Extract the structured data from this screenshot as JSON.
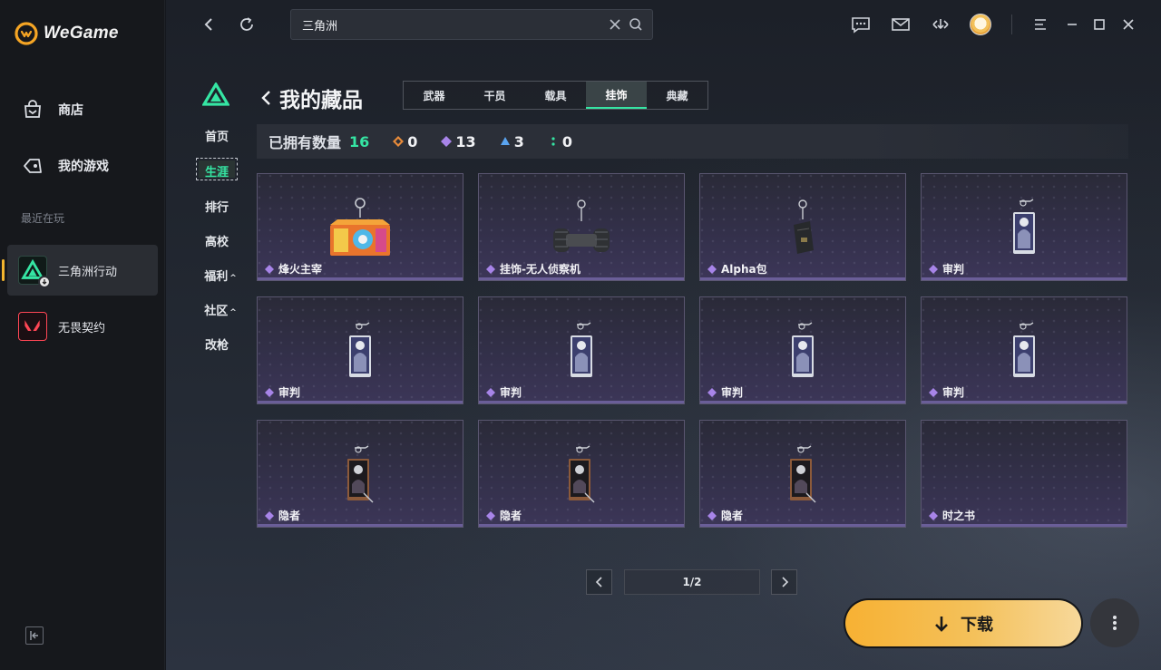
{
  "app": {
    "brand": "WeGame"
  },
  "sidebar": {
    "nav": [
      {
        "label": "商店",
        "icon": "shop-bag-icon"
      },
      {
        "label": "我的游戏",
        "icon": "gamepad-icon"
      }
    ],
    "recent_label": "最近在玩",
    "games": [
      {
        "label": "三角洲行动",
        "icon": "delta-force-icon",
        "active": true
      },
      {
        "label": "无畏契约",
        "icon": "valorant-icon",
        "active": false
      }
    ]
  },
  "topbar": {
    "search_value": "三角洲"
  },
  "game_nav": {
    "items": [
      "首页",
      "生涯",
      "排行",
      "高校",
      "福利",
      "社区",
      "改枪"
    ],
    "active": "生涯",
    "expandable": [
      "福利",
      "社区"
    ]
  },
  "collection": {
    "title": "我的藏品",
    "tabs": [
      "武器",
      "干员",
      "载具",
      "挂饰",
      "典藏"
    ],
    "active_tab": "挂饰",
    "stats": {
      "label": "已拥有数量",
      "total": "16",
      "tiers": [
        {
          "color": "#e88b3a",
          "value": "0"
        },
        {
          "color": "#a784e8",
          "value": "13"
        },
        {
          "color": "#5aa4f0",
          "value": "3"
        },
        {
          "color": "#35e5a3",
          "value": "0"
        }
      ]
    },
    "items": [
      {
        "name": "烽火主宰",
        "image": "colorful-bag-charm"
      },
      {
        "name": "挂饰-无人侦察机",
        "image": "drone-charm"
      },
      {
        "name": "Alpha包",
        "image": "small-pouch-charm"
      },
      {
        "name": "审判",
        "image": "judgment-card-charm"
      },
      {
        "name": "审判",
        "image": "judgment-card-charm"
      },
      {
        "name": "审判",
        "image": "judgment-card-charm"
      },
      {
        "name": "审判",
        "image": "judgment-card-charm"
      },
      {
        "name": "审判",
        "image": "judgment-card-charm"
      },
      {
        "name": "隐者",
        "image": "hermit-card-charm"
      },
      {
        "name": "隐者",
        "image": "hermit-card-charm"
      },
      {
        "name": "隐者",
        "image": "hermit-card-charm"
      },
      {
        "name": "时之书",
        "image": "empty"
      }
    ],
    "pagination": "1/2"
  },
  "actions": {
    "download_label": "下载"
  },
  "colors": {
    "accent_green": "#35e5a3",
    "download_orange": "#f7b133",
    "rarity_purple": "#a784e8"
  }
}
